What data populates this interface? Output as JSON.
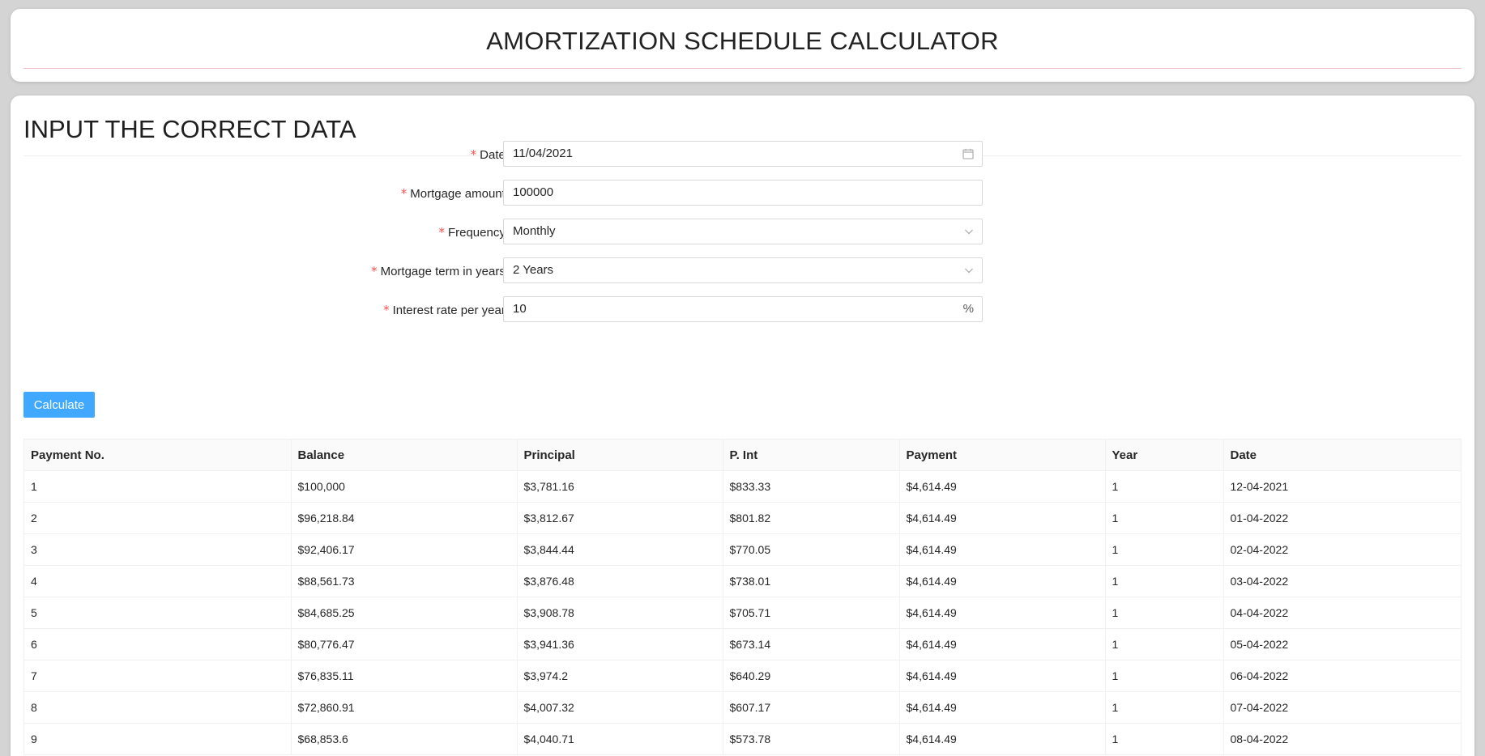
{
  "header": {
    "title": "AMORTIZATION SCHEDULE CALCULATOR"
  },
  "form": {
    "section_title": "INPUT THE CORRECT DATA",
    "date": {
      "label": "Date",
      "value": "11/04/2021",
      "icon": "calendar-icon"
    },
    "mortgage_amount": {
      "label": "Mortgage amount",
      "value": "100000"
    },
    "frequency": {
      "label": "Frequency",
      "value": "Monthly",
      "icon": "chevron-down-icon"
    },
    "term": {
      "label": "Mortgage term in years",
      "value": "2 Years",
      "icon": "chevron-down-icon"
    },
    "interest": {
      "label": "Interest rate per year",
      "value": "10",
      "suffix": "%"
    },
    "required_mark": "*",
    "colon": ":",
    "calculate_label": "Calculate"
  },
  "table": {
    "columns": [
      "Payment No.",
      "Balance",
      "Principal",
      "P. Int",
      "Payment",
      "Year",
      "Date"
    ],
    "rows": [
      [
        "1",
        "$100,000",
        "$3,781.16",
        "$833.33",
        "$4,614.49",
        "1",
        "12-04-2021"
      ],
      [
        "2",
        "$96,218.84",
        "$3,812.67",
        "$801.82",
        "$4,614.49",
        "1",
        "01-04-2022"
      ],
      [
        "3",
        "$92,406.17",
        "$3,844.44",
        "$770.05",
        "$4,614.49",
        "1",
        "02-04-2022"
      ],
      [
        "4",
        "$88,561.73",
        "$3,876.48",
        "$738.01",
        "$4,614.49",
        "1",
        "03-04-2022"
      ],
      [
        "5",
        "$84,685.25",
        "$3,908.78",
        "$705.71",
        "$4,614.49",
        "1",
        "04-04-2022"
      ],
      [
        "6",
        "$80,776.47",
        "$3,941.36",
        "$673.14",
        "$4,614.49",
        "1",
        "05-04-2022"
      ],
      [
        "7",
        "$76,835.11",
        "$3,974.2",
        "$640.29",
        "$4,614.49",
        "1",
        "06-04-2022"
      ],
      [
        "8",
        "$72,860.91",
        "$4,007.32",
        "$607.17",
        "$4,614.49",
        "1",
        "07-04-2022"
      ],
      [
        "9",
        "$68,853.6",
        "$4,040.71",
        "$573.78",
        "$4,614.49",
        "1",
        "08-04-2022"
      ]
    ]
  },
  "colors": {
    "accent": "#40a9ff",
    "required": "#ff4d4f",
    "header_rule": "#f0c4c4"
  }
}
